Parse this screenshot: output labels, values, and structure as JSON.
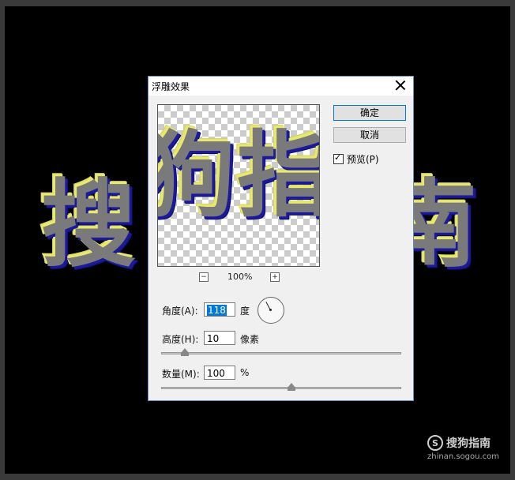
{
  "background_text": {
    "char1": "搜",
    "char2": "南"
  },
  "watermark": {
    "logo_text": "搜狗指南",
    "logo_letter": "S",
    "url": "zhinan.sogou.com"
  },
  "dialog": {
    "title": "浮雕效果",
    "preview_chars": {
      "char1": "狗",
      "char2": "指"
    },
    "zoom": {
      "minus": "−",
      "plus": "+",
      "level": "100%"
    },
    "ok_label": "确定",
    "cancel_label": "取消",
    "preview_checkbox": {
      "label": "预览(P)",
      "checked": true
    },
    "angle": {
      "label": "角度(A):",
      "value": "118",
      "unit": "度"
    },
    "height": {
      "label": "高度(H):",
      "value": "10",
      "unit": "像素",
      "slider_fraction": 0.1
    },
    "amount": {
      "label": "数量(M):",
      "value": "100",
      "unit": "%",
      "slider_fraction": 0.54
    }
  },
  "colors": {
    "accent": "#0078d7",
    "emboss_dark": "#1a1a9a",
    "emboss_light": "#e8e870"
  }
}
